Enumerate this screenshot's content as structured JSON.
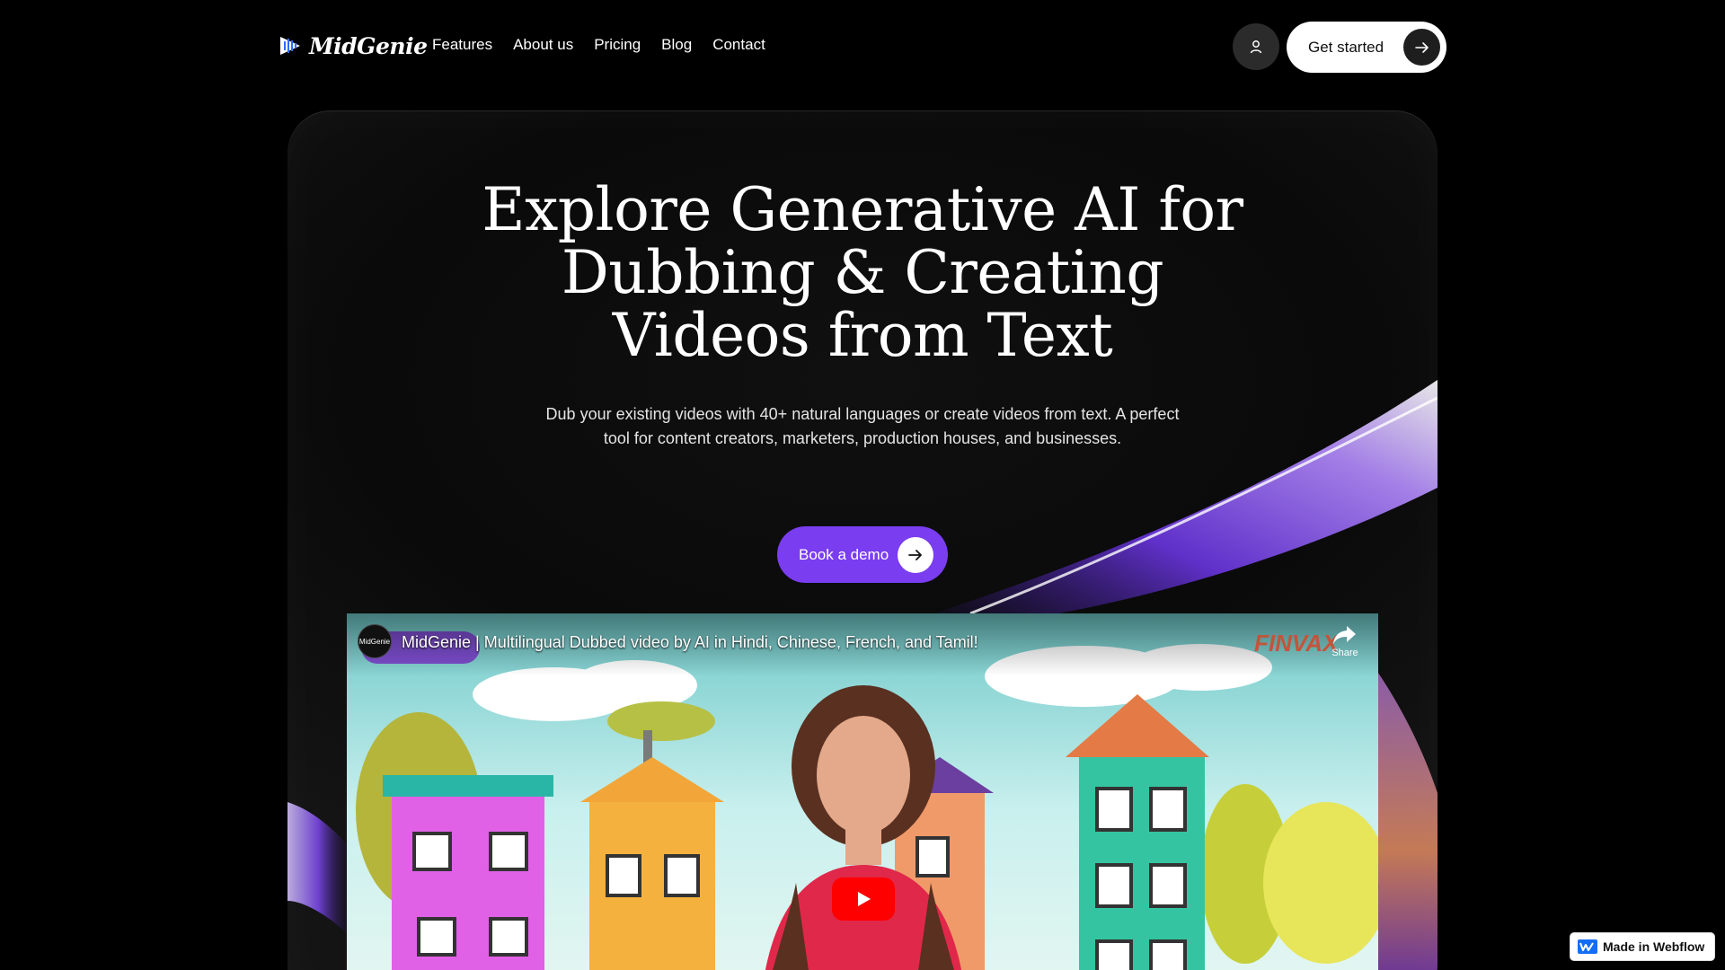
{
  "nav": {
    "logo_text": "MidGenie",
    "links": [
      "Features",
      "About us",
      "Pricing",
      "Blog",
      "Contact"
    ],
    "cta_label": "Get started"
  },
  "hero": {
    "title_lines": [
      "Explore Generative AI for",
      "Dubbing & Creating",
      "Videos from Text"
    ],
    "subtitle_lines": [
      "Dub your existing videos with 40+ natural languages or create videos from text. A perfect",
      "tool for content creators, marketers, production houses, and businesses."
    ],
    "demo_label": "Book a demo"
  },
  "video": {
    "title": "MidGenie | Multilingual Dubbed video by AI in Hindi, Chinese, French, and Tamil!",
    "channel_label": "MidGenie",
    "share_label": "Share",
    "watermark": "FINVAX"
  },
  "webflow_badge": "Made in Webflow",
  "colors": {
    "accent": "#7a3df0",
    "background": "#000000",
    "play": "#ff0000"
  }
}
